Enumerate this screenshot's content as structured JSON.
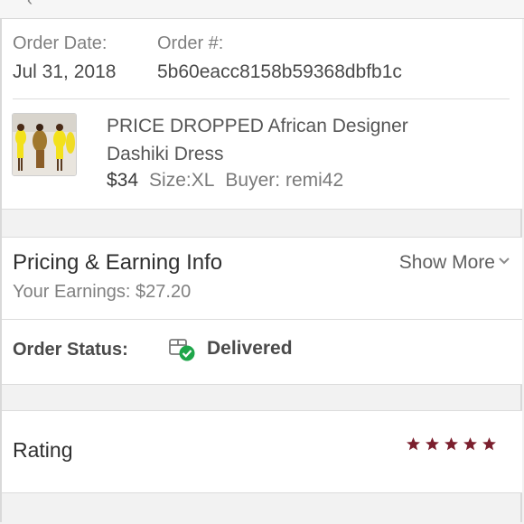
{
  "order": {
    "date_label": "Order Date:",
    "date_value": "Jul 31, 2018",
    "number_label": "Order #:",
    "number_value": "5b60eacc8158b59368dbfb1c"
  },
  "item": {
    "title_line1": "PRICE DROPPED African Designer",
    "title_line2": "Dashiki Dress",
    "price": "$34",
    "size": "Size:XL",
    "buyer": "Buyer: remi42"
  },
  "pricing": {
    "title": "Pricing & Earning Info",
    "earnings": "Your Earnings: $27.20",
    "show_more": "Show More"
  },
  "status": {
    "label": "Order Status:",
    "value": "Delivered",
    "icon": "delivered-box-check-icon",
    "check_color": "#1fa64a"
  },
  "rating": {
    "label": "Rating",
    "stars": 5,
    "star_color": "#7b1f2e"
  }
}
